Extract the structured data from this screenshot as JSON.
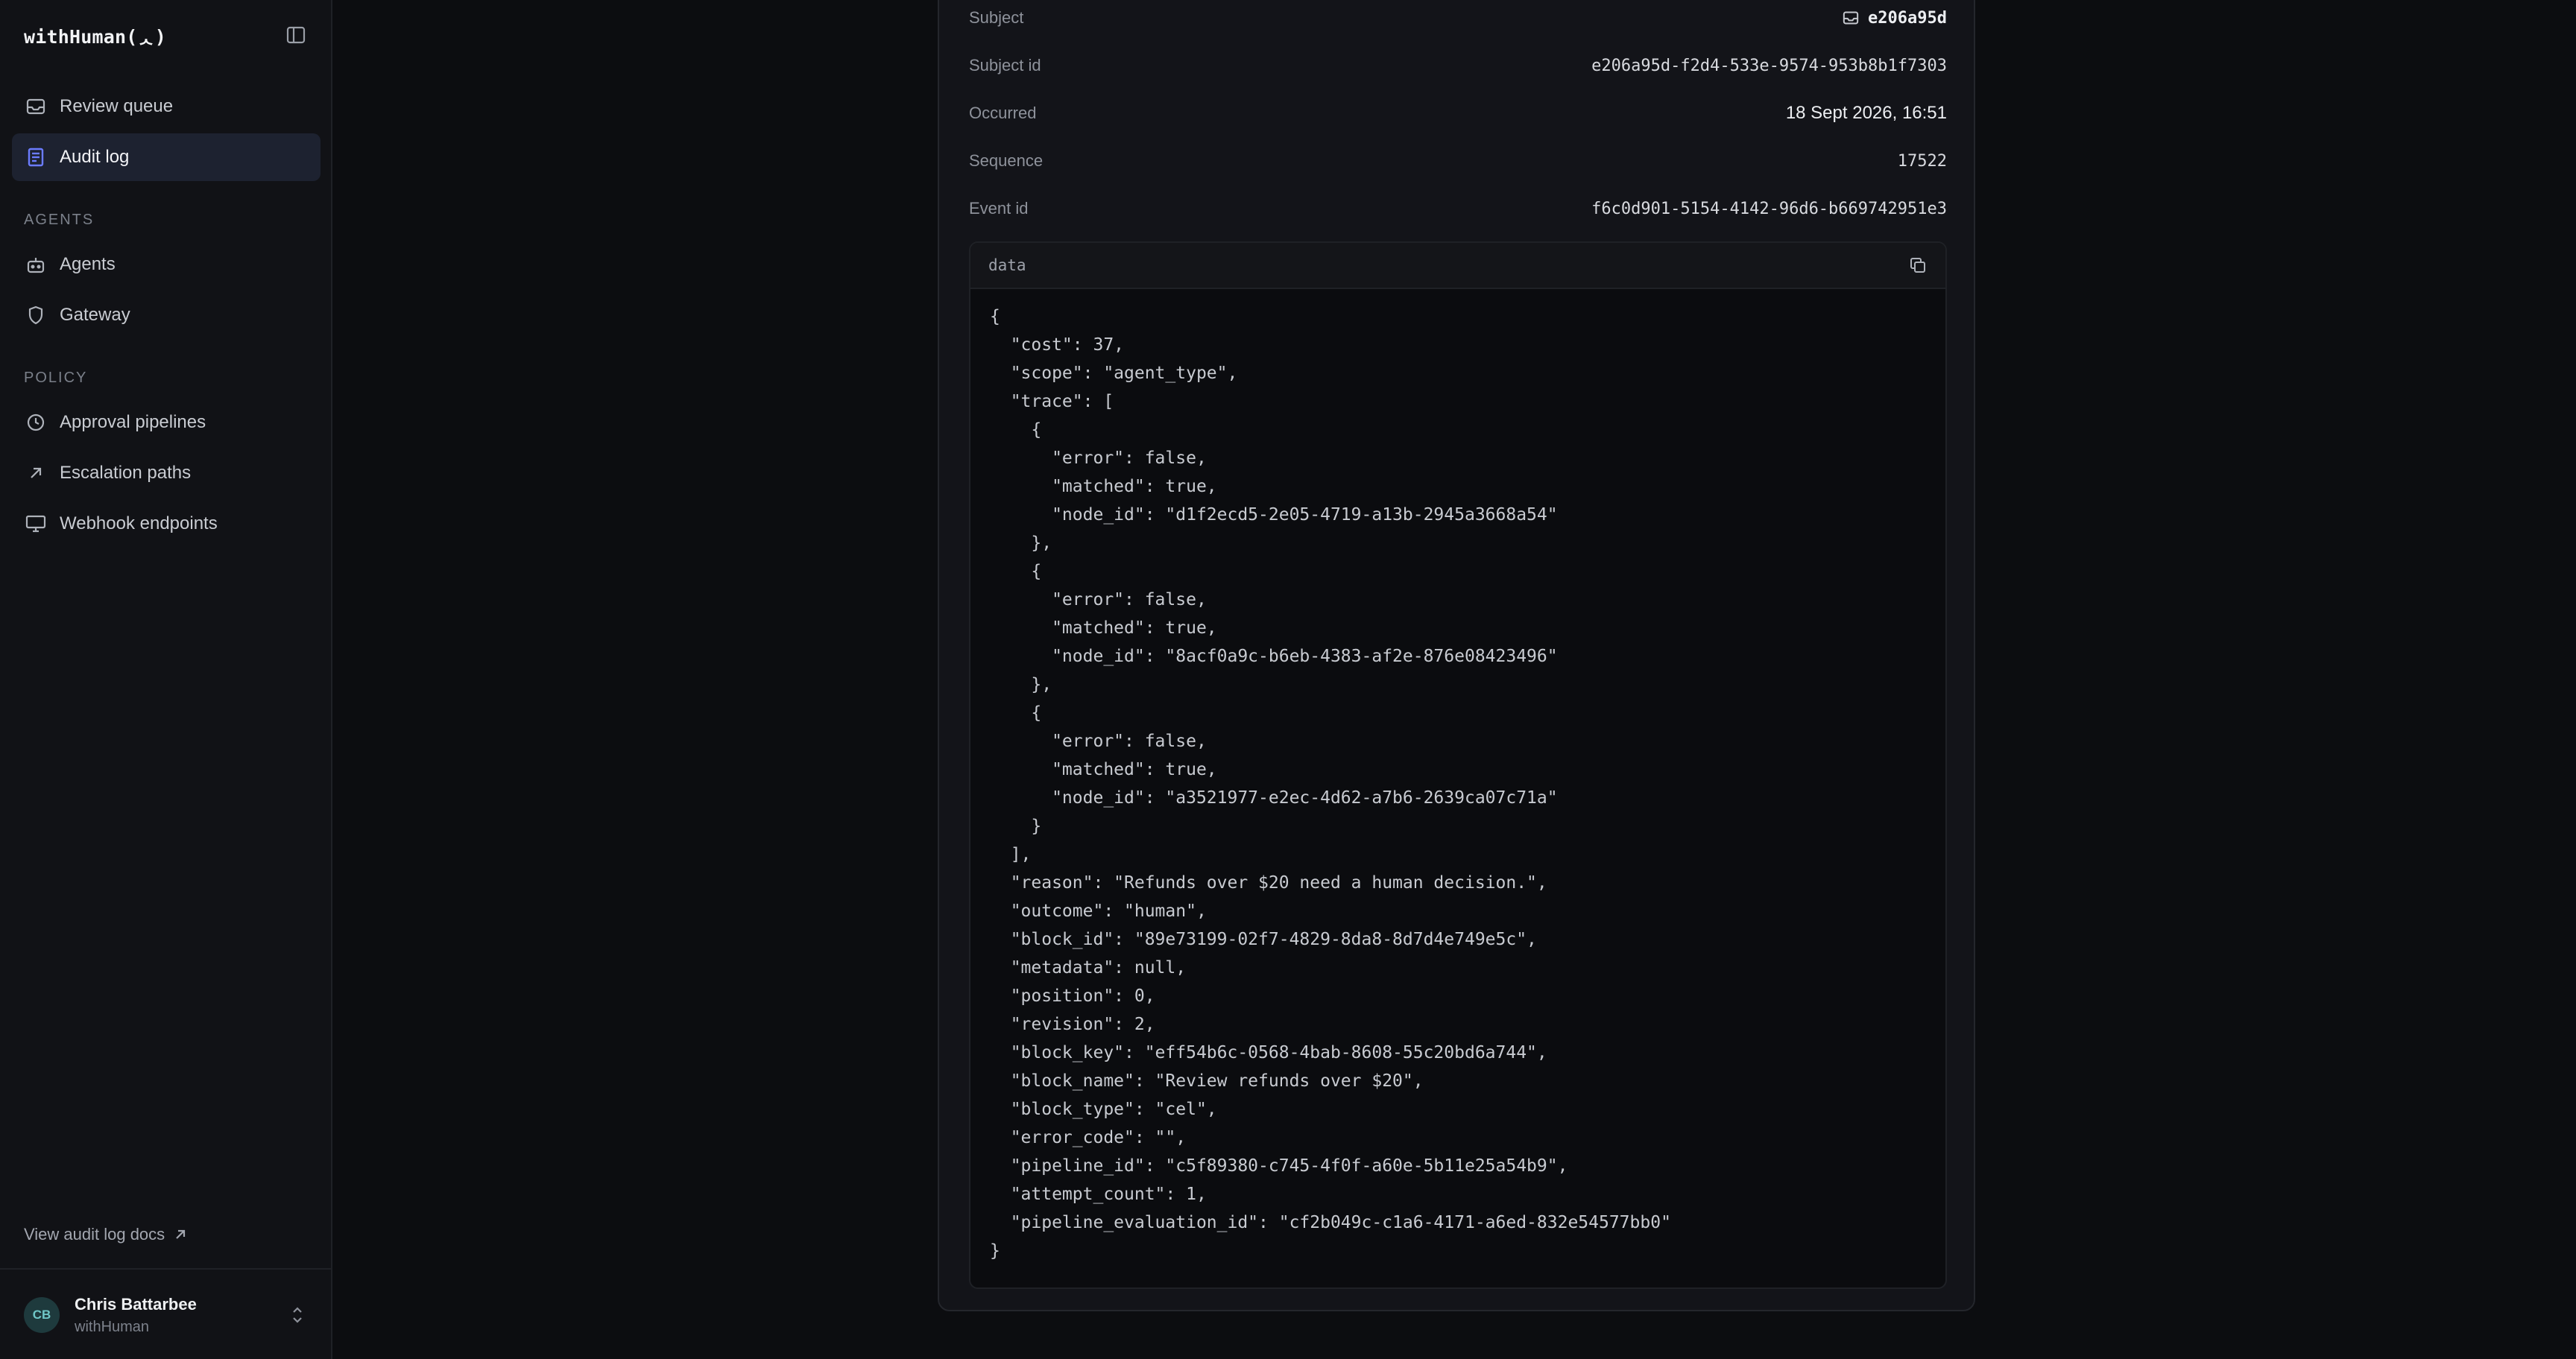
{
  "brand": "withHuman(ᆺ)",
  "nav": {
    "review_queue": "Review queue",
    "audit_log": "Audit log",
    "agents_section": "AGENTS",
    "agents": "Agents",
    "gateway": "Gateway",
    "policy_section": "POLICY",
    "approval_pipelines": "Approval pipelines",
    "escalation_paths": "Escalation paths",
    "webhook_endpoints": "Webhook endpoints"
  },
  "docs_link": "View audit log docs",
  "user": {
    "initials": "CB",
    "name": "Chris Battarbee",
    "org": "withHuman"
  },
  "event": {
    "subject_label": "Subject",
    "subject_value": "e206a95d",
    "subject_id_label": "Subject id",
    "subject_id_value": "e206a95d-f2d4-533e-9574-953b8b1f7303",
    "occurred_label": "Occurred",
    "occurred_value": "18 Sept 2026, 16:51",
    "sequence_label": "Sequence",
    "sequence_value": "17522",
    "event_id_label": "Event id",
    "event_id_value": "f6c0d901-5154-4142-96d6-b669742951e3"
  },
  "data_panel": {
    "title": "data",
    "json_text": "{\n  \"cost\": 37,\n  \"scope\": \"agent_type\",\n  \"trace\": [\n    {\n      \"error\": false,\n      \"matched\": true,\n      \"node_id\": \"d1f2ecd5-2e05-4719-a13b-2945a3668a54\"\n    },\n    {\n      \"error\": false,\n      \"matched\": true,\n      \"node_id\": \"8acf0a9c-b6eb-4383-af2e-876e08423496\"\n    },\n    {\n      \"error\": false,\n      \"matched\": true,\n      \"node_id\": \"a3521977-e2ec-4d62-a7b6-2639ca07c71a\"\n    }\n  ],\n  \"reason\": \"Refunds over $20 need a human decision.\",\n  \"outcome\": \"human\",\n  \"block_id\": \"89e73199-02f7-4829-8da8-8d7d4e749e5c\",\n  \"metadata\": null,\n  \"position\": 0,\n  \"revision\": 2,\n  \"block_key\": \"eff54b6c-0568-4bab-8608-55c20bd6a744\",\n  \"block_name\": \"Review refunds over $20\",\n  \"block_type\": \"cel\",\n  \"error_code\": \"\",\n  \"pipeline_id\": \"c5f89380-c745-4f0f-a60e-5b11e25a54b9\",\n  \"attempt_count\": 1,\n  \"pipeline_evaluation_id\": \"cf2b049c-c1a6-4171-a6ed-832e54577bb0\"\n}"
  },
  "icons": {
    "sidebar_toggle": "sidebar-toggle-icon",
    "inbox": "inbox-icon",
    "document": "document-icon",
    "bot": "bot-icon",
    "shield": "shield-icon",
    "clock": "clock-icon",
    "arrow_up_right": "arrow-up-right-icon",
    "monitor": "monitor-icon",
    "copy": "copy-icon",
    "chevrons": "chevrons-up-down-icon"
  },
  "colors": {
    "accent": "#6b7cff",
    "active_bg": "#1d2230",
    "background": "#0c0d10"
  }
}
